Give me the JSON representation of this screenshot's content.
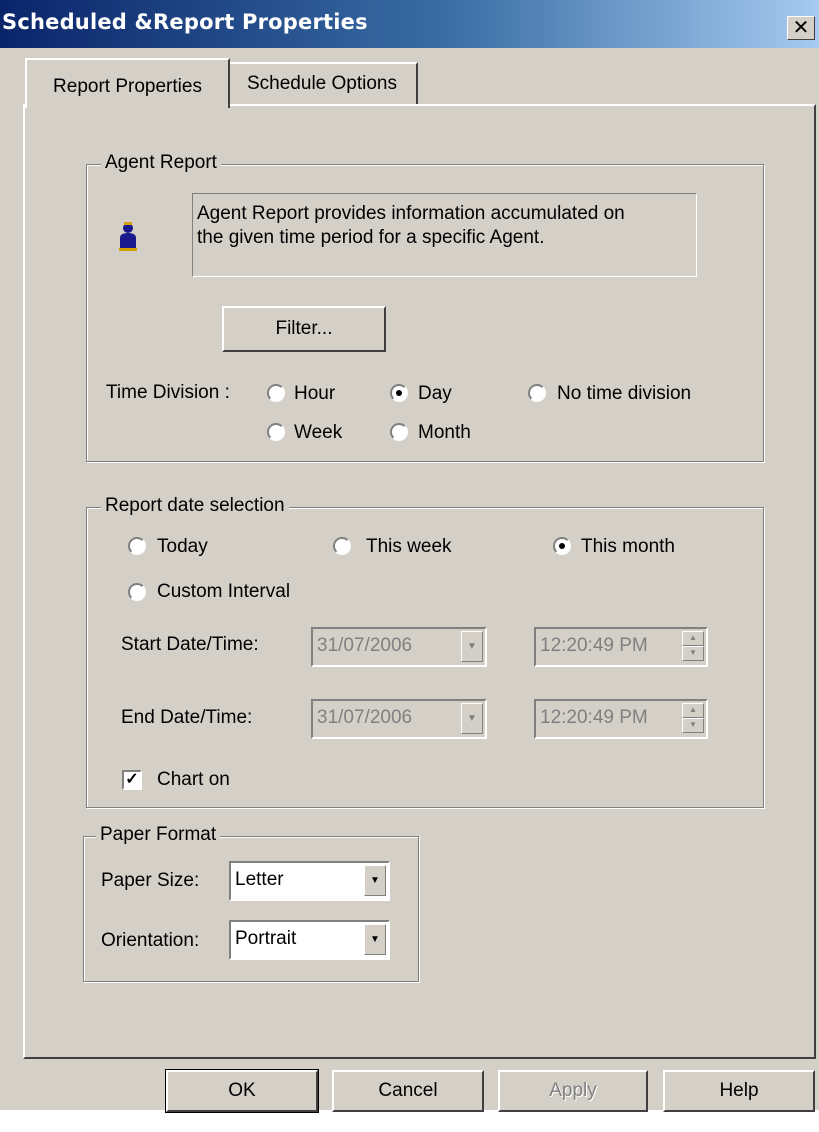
{
  "window": {
    "title": "Scheduled &Report Properties",
    "close_glyph": "✕"
  },
  "tabs": [
    {
      "label": "Report Properties"
    },
    {
      "label": "Schedule Options"
    }
  ],
  "agent_report": {
    "legend": "Agent Report",
    "icon": "agent-icon",
    "description_line1": "Agent Report provides information accumulated on",
    "description_line2": "the given time period for a specific Agent.",
    "filter_label": "Filter...",
    "time_division_label": "Time Division :",
    "options": [
      "Hour",
      "Day",
      "No time division",
      "Week",
      "Month"
    ],
    "selected": "Day"
  },
  "date_selection": {
    "legend": "Report date selection",
    "options": [
      "Today",
      "This week",
      "This month",
      "Custom Interval"
    ],
    "selected": "This month",
    "start_label": "Start Date/Time:",
    "start_date": "31/07/2006",
    "start_time": "12:20:49 PM",
    "end_label": "End Date/Time:",
    "end_date": "31/07/2006",
    "end_time": "12:20:49 PM",
    "chart_label": "Chart on",
    "chart_checked": true
  },
  "paper_format": {
    "legend": "Paper Format",
    "size_label": "Paper Size:",
    "size_value": "Letter",
    "orientation_label": "Orientation:",
    "orientation_value": "Portrait"
  },
  "buttons": {
    "ok": "OK",
    "cancel": "Cancel",
    "apply": "Apply",
    "help": "Help"
  },
  "colors": {
    "title_gradient_start": "#0a246a",
    "title_gradient_end": "#a6caf0",
    "face": "#d4d0c8"
  }
}
